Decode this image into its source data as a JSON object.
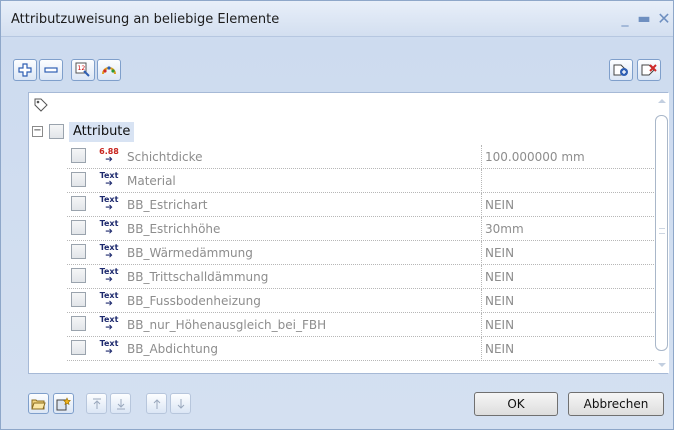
{
  "window": {
    "title": "Attributzuweisung an beliebige Elemente",
    "controls": [
      "minimize-icon",
      "maximize-icon",
      "close-icon"
    ]
  },
  "toolbar": {
    "left_buttons": [
      "add-icon",
      "remove-icon",
      "numbering-icon",
      "palette-icon"
    ],
    "right_buttons": [
      "attribute-add-icon",
      "attribute-delete-icon"
    ]
  },
  "tree": {
    "root_icon": "tag-icon",
    "group": {
      "label": "Attribute",
      "expanded": true,
      "checked": false
    },
    "rows": [
      {
        "icon": "number-attribute-icon",
        "icon_text": "6.88",
        "name": "Schichtdicke",
        "value": "100.000000 mm",
        "checked": false
      },
      {
        "icon": "text-attribute-icon",
        "icon_text": "Text",
        "name": "Material",
        "value": "",
        "checked": false
      },
      {
        "icon": "text-attribute-icon",
        "icon_text": "Text",
        "name": "BB_Estrichart",
        "value": "NEIN",
        "checked": false
      },
      {
        "icon": "text-attribute-icon",
        "icon_text": "Text",
        "name": "BB_Estrichhöhe",
        "value": "30mm",
        "checked": false
      },
      {
        "icon": "text-attribute-icon",
        "icon_text": "Text",
        "name": "BB_Wärmedämmung",
        "value": "NEIN",
        "checked": false
      },
      {
        "icon": "text-attribute-icon",
        "icon_text": "Text",
        "name": "BB_Trittschalldämmung",
        "value": "NEIN",
        "checked": false
      },
      {
        "icon": "text-attribute-icon",
        "icon_text": "Text",
        "name": "BB_Fussbodenheizung",
        "value": "NEIN",
        "checked": false
      },
      {
        "icon": "text-attribute-icon",
        "icon_text": "Text",
        "name": "BB_nur_Höhenausgleich_bei_FBH",
        "value": "NEIN",
        "checked": false
      },
      {
        "icon": "text-attribute-icon",
        "icon_text": "Text",
        "name": "BB_Abdichtung",
        "value": "NEIN",
        "checked": false
      }
    ]
  },
  "bottom_toolbar": {
    "buttons": [
      "open-folder-icon",
      "save-favorite-icon",
      "move-top-icon",
      "move-bottom-icon",
      "move-up-icon",
      "move-down-icon"
    ]
  },
  "dialog_buttons": {
    "ok": "OK",
    "cancel": "Abbrechen"
  },
  "colors": {
    "title_bar": "#d3dff0",
    "selection": "#d8e3f3",
    "disabled_text": "#8d8d8d",
    "accent": "#2f5fb3"
  }
}
